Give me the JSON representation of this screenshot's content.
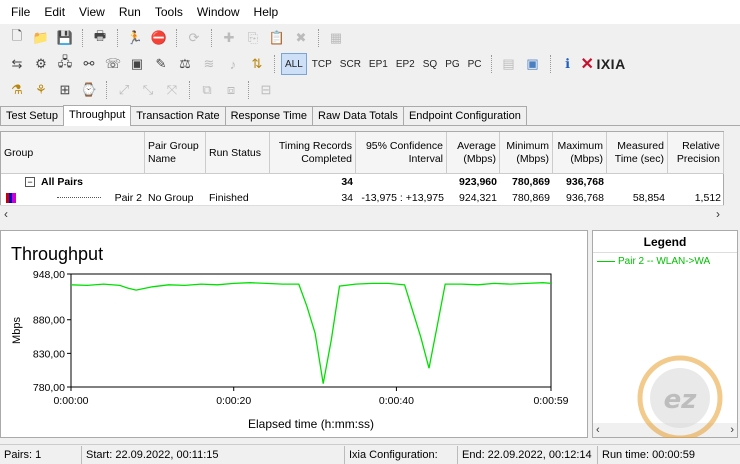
{
  "menu": [
    "File",
    "Edit",
    "View",
    "Run",
    "Tools",
    "Window",
    "Help"
  ],
  "toolbar_protocols": [
    "ALL",
    "TCP",
    "SCR",
    "EP1",
    "EP2",
    "SQ",
    "PG",
    "PC"
  ],
  "brand": "IXIA",
  "tabs": [
    "Test Setup",
    "Throughput",
    "Transaction Rate",
    "Response Time",
    "Raw Data Totals",
    "Endpoint Configuration"
  ],
  "grid": {
    "headers": [
      "Group",
      "Pair Group Name",
      "Run Status",
      "Timing Records Completed",
      "95% Confidence Interval",
      "Average (Mbps)",
      "Minimum (Mbps)",
      "Maximum (Mbps)",
      "Measured Time (sec)",
      "Relative Precision"
    ],
    "summary": {
      "label": "All Pairs",
      "records": "34",
      "average": "923,960",
      "minimum": "780,869",
      "maximum": "936,768"
    },
    "row": {
      "pair": "Pair 2",
      "group": "No Group",
      "status": "Finished",
      "records": "34",
      "ci": "-13,975 : +13,975",
      "average": "924,321",
      "minimum": "780,869",
      "maximum": "936,768",
      "time": "58,854",
      "precision": "1,512"
    }
  },
  "chart_data": {
    "type": "line",
    "title": "Throughput",
    "xlabel": "Elapsed time (h:mm:ss)",
    "ylabel": "Mbps",
    "ylim": [
      780,
      948
    ],
    "xlim": [
      0,
      59
    ],
    "yticks": [
      "948,00",
      "880,00",
      "830,00",
      "780,00"
    ],
    "ytick_values": [
      948,
      880,
      830,
      780
    ],
    "xticks": [
      "0:00:00",
      "0:00:20",
      "0:00:40",
      "0:00:59"
    ],
    "xtick_values": [
      0,
      20,
      40,
      59
    ],
    "series": [
      {
        "name": "Pair 2 -- WLAN->WA",
        "color": "#00e000",
        "x": [
          0,
          2,
          4,
          6,
          7,
          8,
          10,
          12,
          14,
          16,
          18,
          20,
          22,
          24,
          26,
          28,
          29,
          30,
          31,
          32,
          33,
          35,
          37,
          39,
          40,
          41,
          42,
          43,
          44,
          45,
          46,
          48,
          50,
          52,
          54,
          56,
          58,
          59
        ],
        "y": [
          932,
          931,
          933,
          931,
          927,
          924,
          929,
          932,
          931,
          933,
          932,
          934,
          935,
          934,
          933,
          933,
          900,
          860,
          785,
          850,
          930,
          933,
          934,
          934,
          933,
          932,
          893,
          854,
          808,
          870,
          933,
          933,
          932,
          934,
          933,
          934,
          935,
          934
        ]
      }
    ]
  },
  "legend": {
    "title": "Legend",
    "entry": "Pair 2 -- WLAN->WA"
  },
  "status": {
    "pairs": "Pairs: 1",
    "start": "Start: 22.09.2022, 00:11:15",
    "config": "Ixia Configuration:",
    "end": "End: 22.09.2022, 00:12:14",
    "runtime": "Run time: 00:00:59"
  }
}
